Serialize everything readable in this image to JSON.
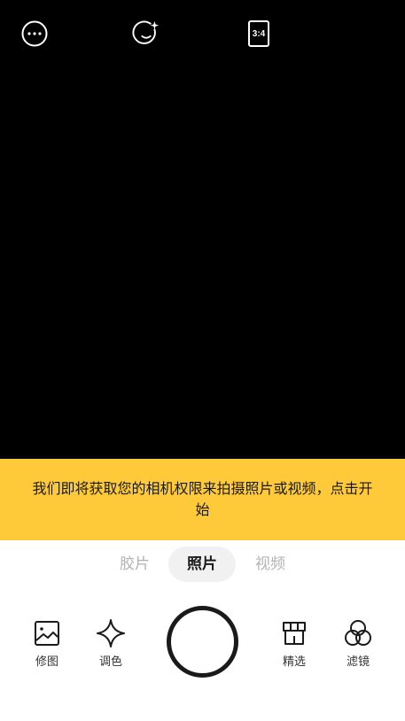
{
  "top_bar": {
    "more_icon": "more-icon",
    "beauty_icon": "beauty-face-icon",
    "ratio_label": "3:4"
  },
  "permission_banner": {
    "text": "我们即将获取您的相机权限来拍摄照片或视频，点击开始",
    "background": "#FFCA3A"
  },
  "modes": {
    "items": [
      {
        "label": "胶片"
      },
      {
        "label": "照片"
      },
      {
        "label": "视频"
      }
    ],
    "selected": "照片"
  },
  "tools": {
    "edit": {
      "label": "修图",
      "icon": "image-icon"
    },
    "color": {
      "label": "调色",
      "icon": "sparkle-icon"
    },
    "featured": {
      "label": "精选",
      "icon": "shop-icon"
    },
    "filter": {
      "label": "滤镜",
      "icon": "filter-circles-icon"
    }
  }
}
